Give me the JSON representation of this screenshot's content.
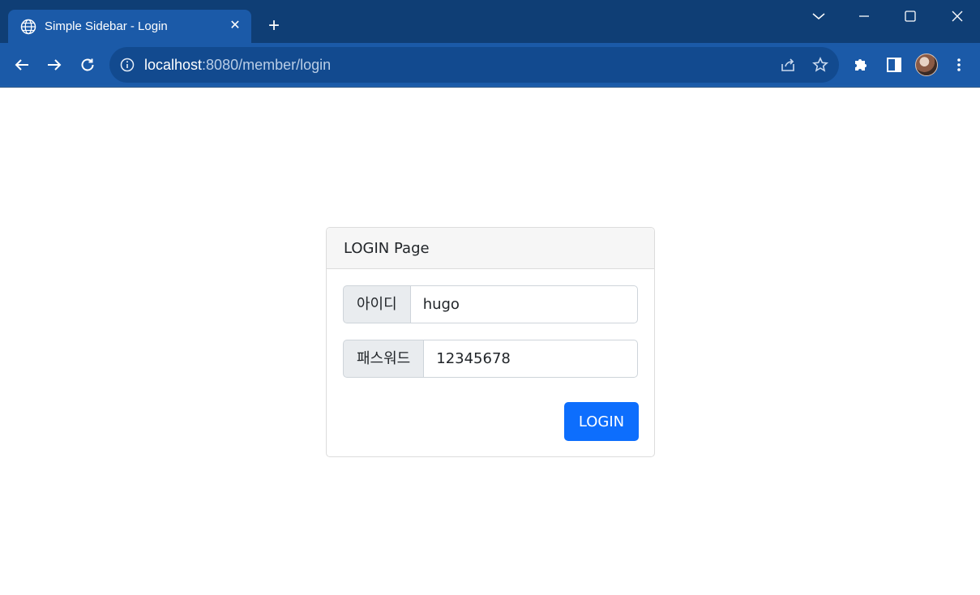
{
  "browser": {
    "tab": {
      "title": "Simple Sidebar - Login",
      "favicon": "globe-icon"
    },
    "address": {
      "host": "localhost",
      "path": ":8080/member/login"
    },
    "colors": {
      "frame": "#0f3e75",
      "toolbar": "#1b5aa8"
    }
  },
  "page": {
    "card": {
      "title": "LOGIN Page",
      "fields": [
        {
          "label": "아이디",
          "value": "hugo"
        },
        {
          "label": "패스워드",
          "value": "12345678"
        }
      ],
      "submit_label": "LOGIN"
    },
    "colors": {
      "primary": "#0d6efd",
      "addon_bg": "#e9ecef"
    }
  }
}
